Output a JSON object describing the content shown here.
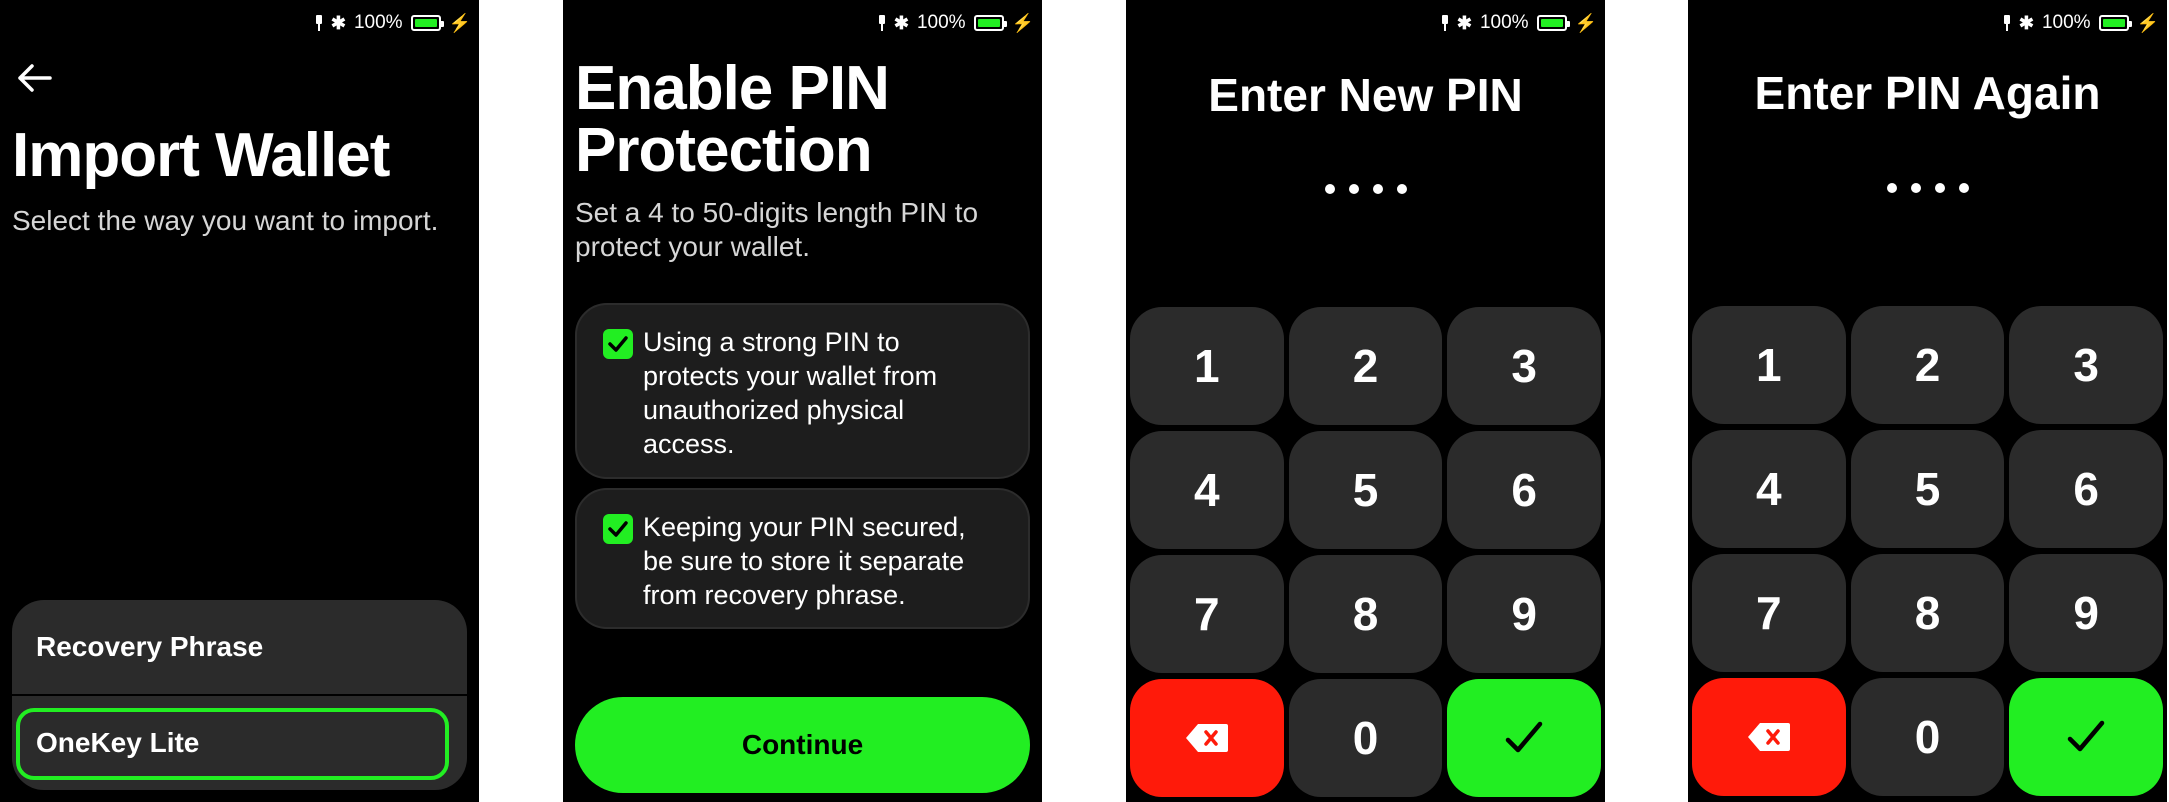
{
  "status_bar": {
    "battery_percent": "100%",
    "battery_color": "#22ee22"
  },
  "screen1": {
    "title": "Import Wallet",
    "subtitle": "Select the way you want to import.",
    "options": [
      {
        "label": "Recovery Phrase"
      },
      {
        "label": "OneKey Lite"
      }
    ]
  },
  "screen2": {
    "title_line1": "Enable PIN",
    "title_line2": "Protection",
    "subtitle_line1": "Set a 4 to 50-digits length PIN to",
    "subtitle_line2": "protect your wallet.",
    "checks": [
      {
        "lines": [
          "Using a strong PIN to",
          "protects your wallet from",
          "unauthorized physical",
          "access."
        ]
      },
      {
        "lines": [
          "Keeping your PIN secured,",
          "be sure to store it separate",
          "from recovery phrase."
        ]
      }
    ],
    "continue_label": "Continue"
  },
  "screen3": {
    "title": "Enter New PIN",
    "dots": 4
  },
  "screen4": {
    "title": "Enter PIN Again",
    "dots": 4
  },
  "keypad": {
    "keys": [
      "1",
      "2",
      "3",
      "4",
      "5",
      "6",
      "7",
      "8",
      "9",
      "",
      "0",
      ""
    ],
    "delete_icon": "backspace-icon",
    "confirm_icon": "check-icon",
    "delete_color": "#ff1a0a",
    "confirm_color": "#22ee22"
  },
  "accent_color": "#22ee22"
}
